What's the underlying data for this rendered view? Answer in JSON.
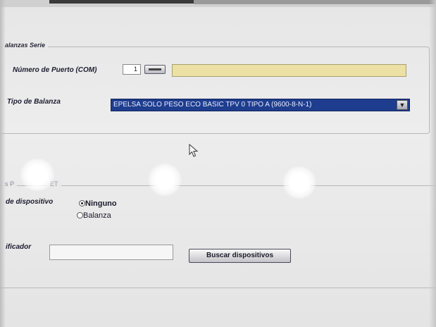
{
  "balanzas_serie": {
    "legend": "alanzas Serie",
    "port_label": "Número de Puerto (COM)",
    "port_value": "1",
    "tipo_label": "Tipo de Balanza",
    "tipo_selected": "EPELSA SOLO PESO ECO BASIC TPV 0 TIPO A (9600-8-N-1)"
  },
  "second_group": {
    "legend_left": "s P",
    "legend_right": "ET",
    "dispositivo_label": "de dispositivo",
    "radio_ninguno": "Ninguno",
    "radio_balanza": "Balanza",
    "identificador_label": "ificador",
    "buscar_button": "Buscar dispositivos"
  },
  "icons": {
    "dropdown": "chevron-down-icon",
    "cursor": "mouse-pointer-icon"
  },
  "colors": {
    "select_bg": "#1e3d8e",
    "yellow_field": "#ece0a4"
  }
}
